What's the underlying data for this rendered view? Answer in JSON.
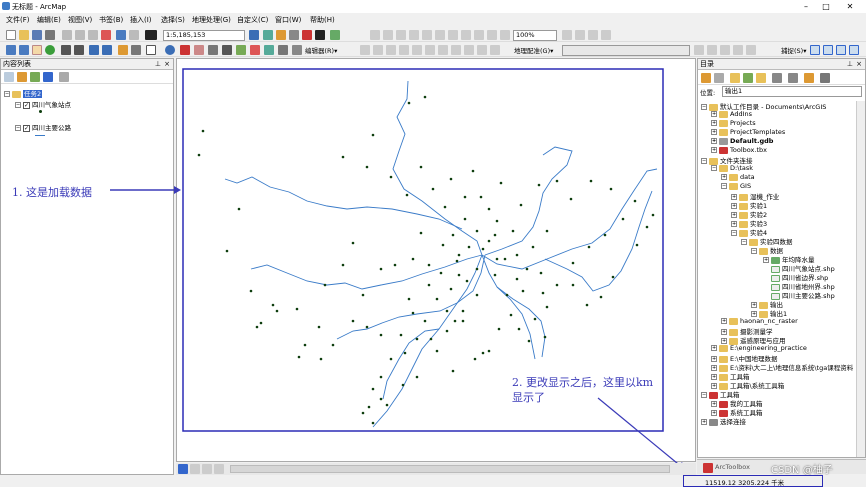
{
  "window": {
    "title": "无标题 - ArcMap",
    "minimize": "–",
    "maximize": "□",
    "close": "✕"
  },
  "menu": [
    "文件(F)",
    "编辑(E)",
    "视图(V)",
    "书签(B)",
    "插入(I)",
    "选择(S)",
    "地理处理(G)",
    "自定义(C)",
    "窗口(W)",
    "帮助(H)"
  ],
  "toolbar": {
    "scale": "1:5,185,153",
    "zoom": "100%",
    "editor": "编辑器(R)▾",
    "georef": "地理配准(G)▾",
    "snapping": "捕捉(S)▾"
  },
  "toc": {
    "title": "内容列表",
    "layers": [
      {
        "name": "任务2",
        "kind": "group"
      },
      {
        "name": "四川气象站点",
        "kind": "point"
      },
      {
        "name": "四川主要公路",
        "kind": "line"
      }
    ]
  },
  "catalog": {
    "title": "目录",
    "location_label": "位置:",
    "location_value": "输出1",
    "items": [
      "默认工作目录 - Documents\\ArcGIS",
      "AddIns",
      "Projects",
      "ProjectTemplates",
      "Default.gdb",
      "Toolbox.tbx",
      "文件夹连接",
      "D:\\task",
      "data",
      "GIS",
      "湿機_作业",
      "实验1",
      "实验2",
      "实验3",
      "实验4",
      "实验四数据",
      "数据",
      "年均降水量",
      "四川气象站点.shp",
      "四川省边界.shp",
      "四川省地州界.shp",
      "四川主要公路.shp",
      "输出",
      "输出1",
      "haonan_nc_raster",
      "摄影测量学",
      "遥感原理与应用",
      "E:\\engineering_practice",
      "E:\\中国地理数据",
      "E:\\资料\\大二上\\地理信息系统\\tga课程资料",
      "工具箱",
      "工具箱\\系统工具箱",
      "工具箱",
      "我的工具箱",
      "系统工具箱",
      "选择连接"
    ]
  },
  "annotations": {
    "a1": "1. 这是加载数据",
    "a2_line1": "2. 更改显示之后，这里以km",
    "a2_line2": "显示了"
  },
  "status": {
    "coords": "11519.12  3205.224 千米",
    "watermark": "CSDN @柚子",
    "arctoolbox": "ArcToolbox"
  },
  "colors": {
    "accent": "#2b2bb5",
    "points": "#0d3d0d",
    "roads": "#3a7bc8"
  }
}
